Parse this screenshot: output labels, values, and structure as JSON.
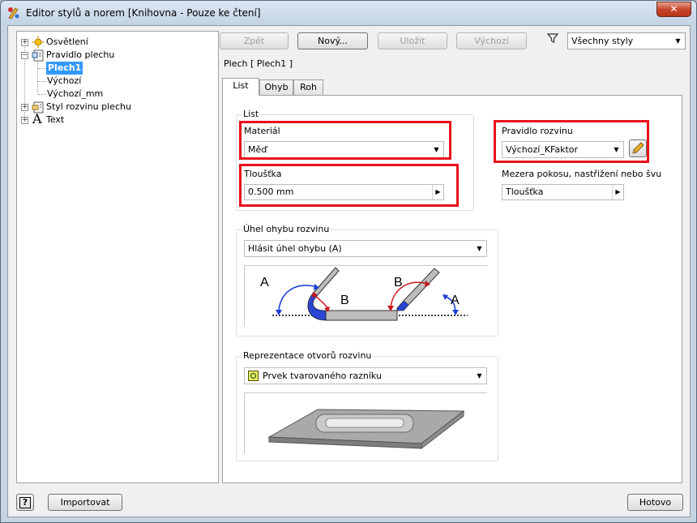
{
  "window": {
    "title": "Editor stylů a norem [Knihovna - Pouze ke čtení]",
    "close_glyph": "✕"
  },
  "tree": {
    "items": [
      {
        "label": "Osvětlení"
      },
      {
        "label": "Pravidlo plechu"
      },
      {
        "label": "Plech1"
      },
      {
        "label": "Výchozí"
      },
      {
        "label": "Výchozí_mm"
      },
      {
        "label": "Styl rozvinu plechu"
      },
      {
        "label": "Text"
      }
    ],
    "text_icon_glyph": "A"
  },
  "toolbar": {
    "back_label": "Zpět",
    "new_label": "Nový...",
    "save_label": "Uložit",
    "default_label": "Výchozí",
    "filter_value": "Všechny styly"
  },
  "panel": {
    "header": "Plech [ Plech1 ]",
    "tabs": [
      "List",
      "Ohyb",
      "Roh"
    ]
  },
  "list_group": {
    "legend": "List",
    "material_label": "Materiál",
    "material_value": "Měď",
    "thickness_label": "Tloušťka",
    "thickness_value": "0.500 mm"
  },
  "unfold": {
    "rule_label": "Pravidlo rozvinu",
    "rule_value": "Výchozí_KFaktor",
    "gap_label": "Mezera pokosu, nastřižení nebo švu",
    "gap_value": "Tloušťka"
  },
  "bend_angle": {
    "legend": "Úhel ohybu rozvinu",
    "value": "Hlásit úhel ohybu (A)",
    "label_a": "A",
    "label_b": "B"
  },
  "punch": {
    "legend": "Reprezentace otvorů rozvinu",
    "value": "Prvek tvarovaného razníku"
  },
  "footer": {
    "help_glyph": "?",
    "import_label": "Importovat",
    "done_label": "Hotovo"
  },
  "colors": {
    "highlight_red": "#e8101b",
    "selection_blue": "#3399ff",
    "bend_blue": "#1f3fd6",
    "bend_red": "#c8141e"
  }
}
